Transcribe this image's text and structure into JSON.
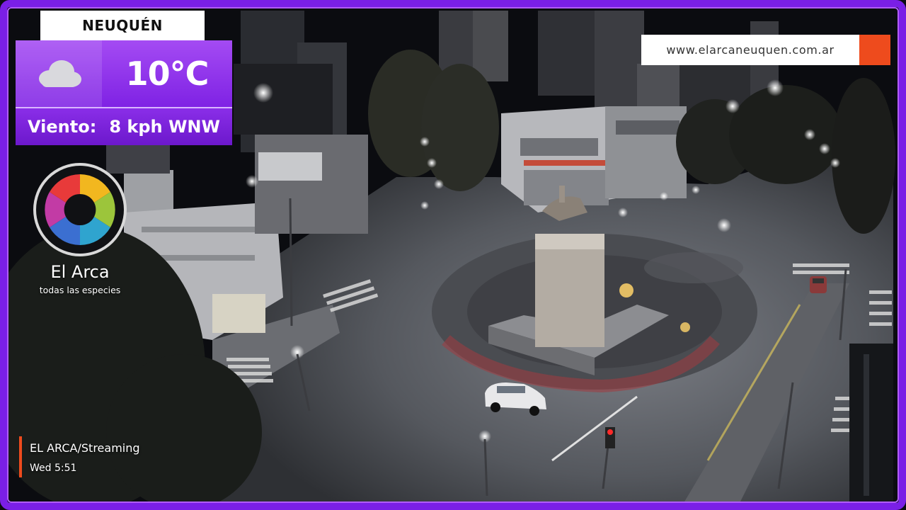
{
  "overlay": {
    "city": "NEUQUÉN",
    "temperature": "10°C",
    "wind_label": "Viento:",
    "wind_value": "8 kph WNW",
    "weather_icon": "cloud-icon",
    "website": "www.elarcaneuquen.com.ar",
    "brand_name": "El Arca",
    "brand_tagline": "todas las especies",
    "stream_title": "EL ARCA/Streaming",
    "stream_time": "Wed 5:51"
  },
  "colors": {
    "frame": "#7a1fe6",
    "weather_panel": "#8f34ec",
    "accent_orange": "#ee4b1d",
    "night_sky": "#0b0c10"
  },
  "scene": {
    "type": "night-street-webcam",
    "subject": "monument-roundabout"
  }
}
